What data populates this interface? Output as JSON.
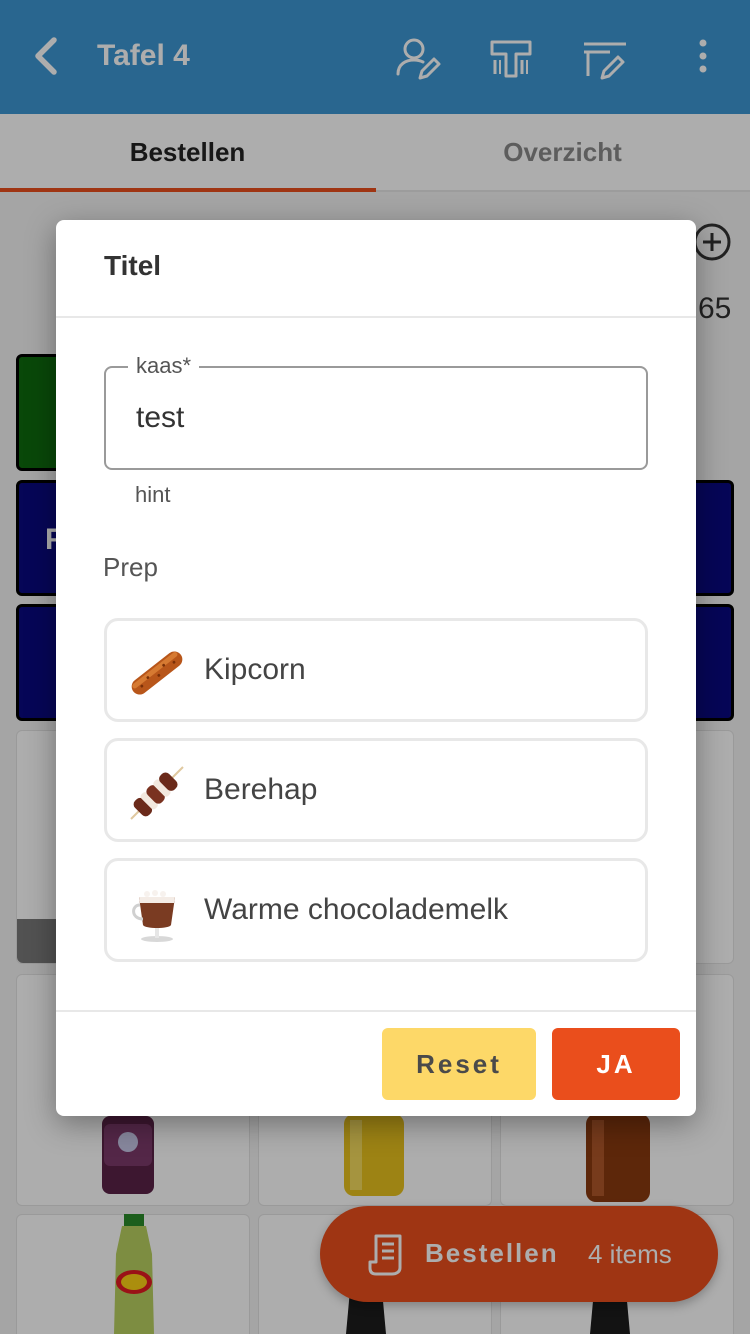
{
  "header": {
    "title": "Tafel 4",
    "background": "#3d97d3",
    "icons": [
      "back-arrow-icon",
      "user-edit-icon",
      "barcode-scanner-icon",
      "table-edit-icon",
      "more-vertical-icon"
    ]
  },
  "tabs": [
    {
      "label": "Bestellen",
      "active": true
    },
    {
      "label": "Overzicht",
      "active": false
    }
  ],
  "background": {
    "side_number": "65",
    "tile_letter": "F"
  },
  "dialog": {
    "title": "Titel",
    "field": {
      "label": "kaas*",
      "value": "test",
      "hint": "hint"
    },
    "section_label": "Prep",
    "options": [
      {
        "label": "Kipcorn",
        "icon": "kipcorn-image"
      },
      {
        "label": "Berehap",
        "icon": "berehap-image"
      },
      {
        "label": "Warme chocolademelk",
        "icon": "hot-chocolate-image"
      }
    ],
    "reset_label": "Reset",
    "confirm_label": "JA"
  },
  "fab": {
    "label": "Bestellen",
    "count": "4 items",
    "color": "#ea4e1c"
  },
  "colors": {
    "accent": "#ea4e1c",
    "reset_button": "#fdd868"
  }
}
